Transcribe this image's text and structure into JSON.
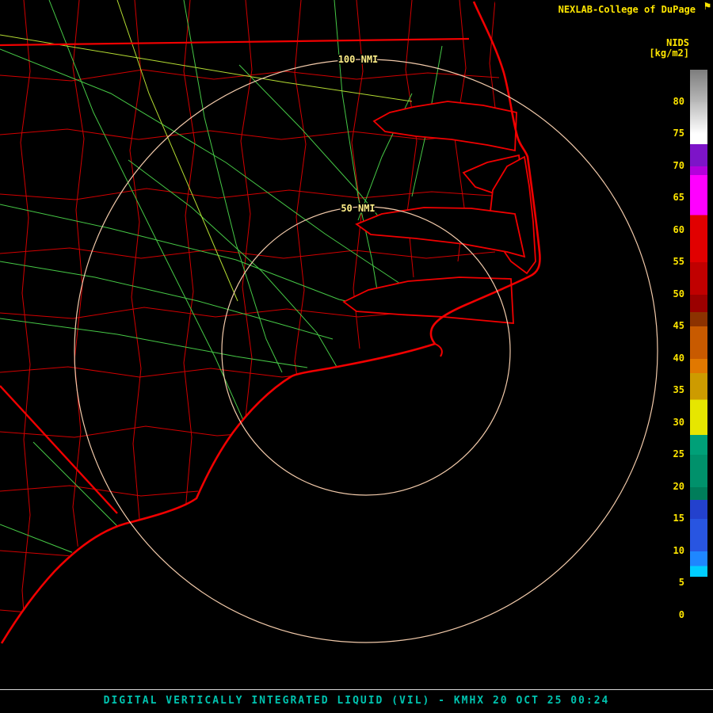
{
  "header": {
    "brand": "NEXLAB-College of DuPage"
  },
  "colorbar": {
    "title": "NIDS",
    "units": "[kg/m2]",
    "ticks": [
      "80",
      "75",
      "70",
      "65",
      "60",
      "55",
      "50",
      "45",
      "40",
      "35",
      "30",
      "25",
      "20",
      "15",
      "10",
      "5",
      "0"
    ],
    "segments": [
      "linear-gradient(#7d7d7d,#b9b9b9)",
      "linear-gradient(#bcbcbc,#ffffff)",
      "linear-gradient(#ffffff 0 32%,#7d14c8 32% 100%)",
      "linear-gradient(#b400dc 0 28%,#ff00ff 28% 100%)",
      "linear-gradient(#ff00ff 0 52%,#e10000 52% 100%)",
      "#e10000",
      "#c00000",
      "linear-gradient(#9b0000 0 55%,#8c3200 55% 100%)",
      "#c85a00",
      "linear-gradient(#e17800 0 45%,#cd9b00 45% 100%)",
      "linear-gradient(#cd9b00 0 28%,#e6e600 28% 100%)",
      "linear-gradient(#e6e600 0 38%,#00a078 38% 100%)",
      "#00916b",
      "linear-gradient(#007d5a 0 40%,#2341cd 40% 100%)",
      "#2855e1",
      "linear-gradient(#1e87ff 0 45%,#00cdff 45% 78%,#000000 78% 100%)",
      "#000000"
    ]
  },
  "map": {
    "ring_labels": [
      "100 NMI",
      "50 NMI"
    ],
    "colors": {
      "coastline": "#f00000",
      "counties": "#d20000",
      "roads": "#46c846",
      "highways": "#b4dc32",
      "rings": "#f2caaa",
      "ring_label_text": "#ffee88"
    }
  },
  "footer": {
    "caption": "DIGITAL VERTICALLY INTEGRATED LIQUID (VIL) - KMHX 20 OCT 25 00:24"
  }
}
